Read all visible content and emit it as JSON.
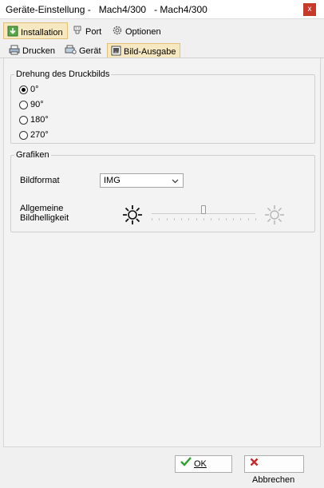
{
  "window": {
    "title": "Geräte-Einstellung -   Mach4/300   - Mach4/300",
    "close_label": "x"
  },
  "main_tabs": [
    {
      "label": "Installation",
      "icon": "install-icon",
      "active": true
    },
    {
      "label": "Port",
      "icon": "port-icon",
      "active": false
    },
    {
      "label": "Optionen",
      "icon": "gear-icon",
      "active": false
    }
  ],
  "sub_tabs": [
    {
      "label": "Drucken",
      "icon": "printer-icon",
      "active": false
    },
    {
      "label": "Gerät",
      "icon": "device-icon",
      "active": false
    },
    {
      "label": "Bild-Ausgabe",
      "icon": "image-icon",
      "active": true
    }
  ],
  "rotation": {
    "legend": "Drehung des Druckbilds",
    "options": [
      "0°",
      "90°",
      "180°",
      "270°"
    ],
    "selected": "0°"
  },
  "graphics": {
    "legend": "Grafiken",
    "format_label": "Bildformat",
    "format_value": "IMG",
    "brightness_label_line1": "Allgemeine",
    "brightness_label_line2": "Bildhelligkeit",
    "brightness_level": 0.5
  },
  "buttons": {
    "ok_label": "OK",
    "cancel_label": "Abbrechen"
  },
  "colors": {
    "active_tab_bg": "#f6e9c2",
    "active_tab_border": "#e3c077",
    "close_button": "#c7392b",
    "ok_check": "#2e9e2e",
    "cancel_x": "#c62828"
  }
}
